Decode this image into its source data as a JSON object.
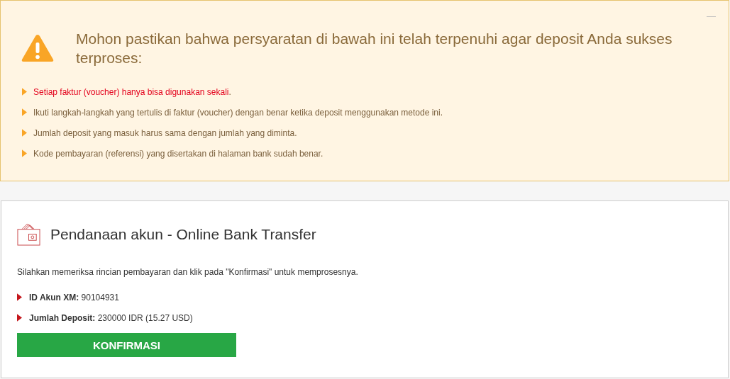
{
  "notice": {
    "minimize": "—",
    "title": "Mohon pastikan bahwa persyaratan di bawah ini telah terpenuhi agar deposit Anda sukses terproses:",
    "items": [
      {
        "text": "Setiap faktur (voucher) hanya bisa digunakan sekali",
        "tail": ".",
        "important": true
      },
      {
        "text": "Ikuti langkah-langkah yang tertulis di faktur (voucher) dengan benar ketika deposit menggunakan metode ini.",
        "important": false
      },
      {
        "text": "Jumlah deposit yang masuk harus sama dengan jumlah yang diminta.",
        "important": false
      },
      {
        "text": "Kode pembayaran (referensi) yang disertakan di halaman bank sudah benar.",
        "important": false
      }
    ]
  },
  "funding": {
    "title": "Pendanaan akun - Online Bank Transfer",
    "instruction": "Silahkan memeriksa rincian pembayaran dan klik pada \"Konfirmasi\" untuk memprosesnya.",
    "details": [
      {
        "label": "ID Akun XM:",
        "value": "90104931"
      },
      {
        "label": "Jumlah Deposit:",
        "value": "230000 IDR (15.27 USD)"
      }
    ],
    "button": "KONFIRMASI"
  }
}
